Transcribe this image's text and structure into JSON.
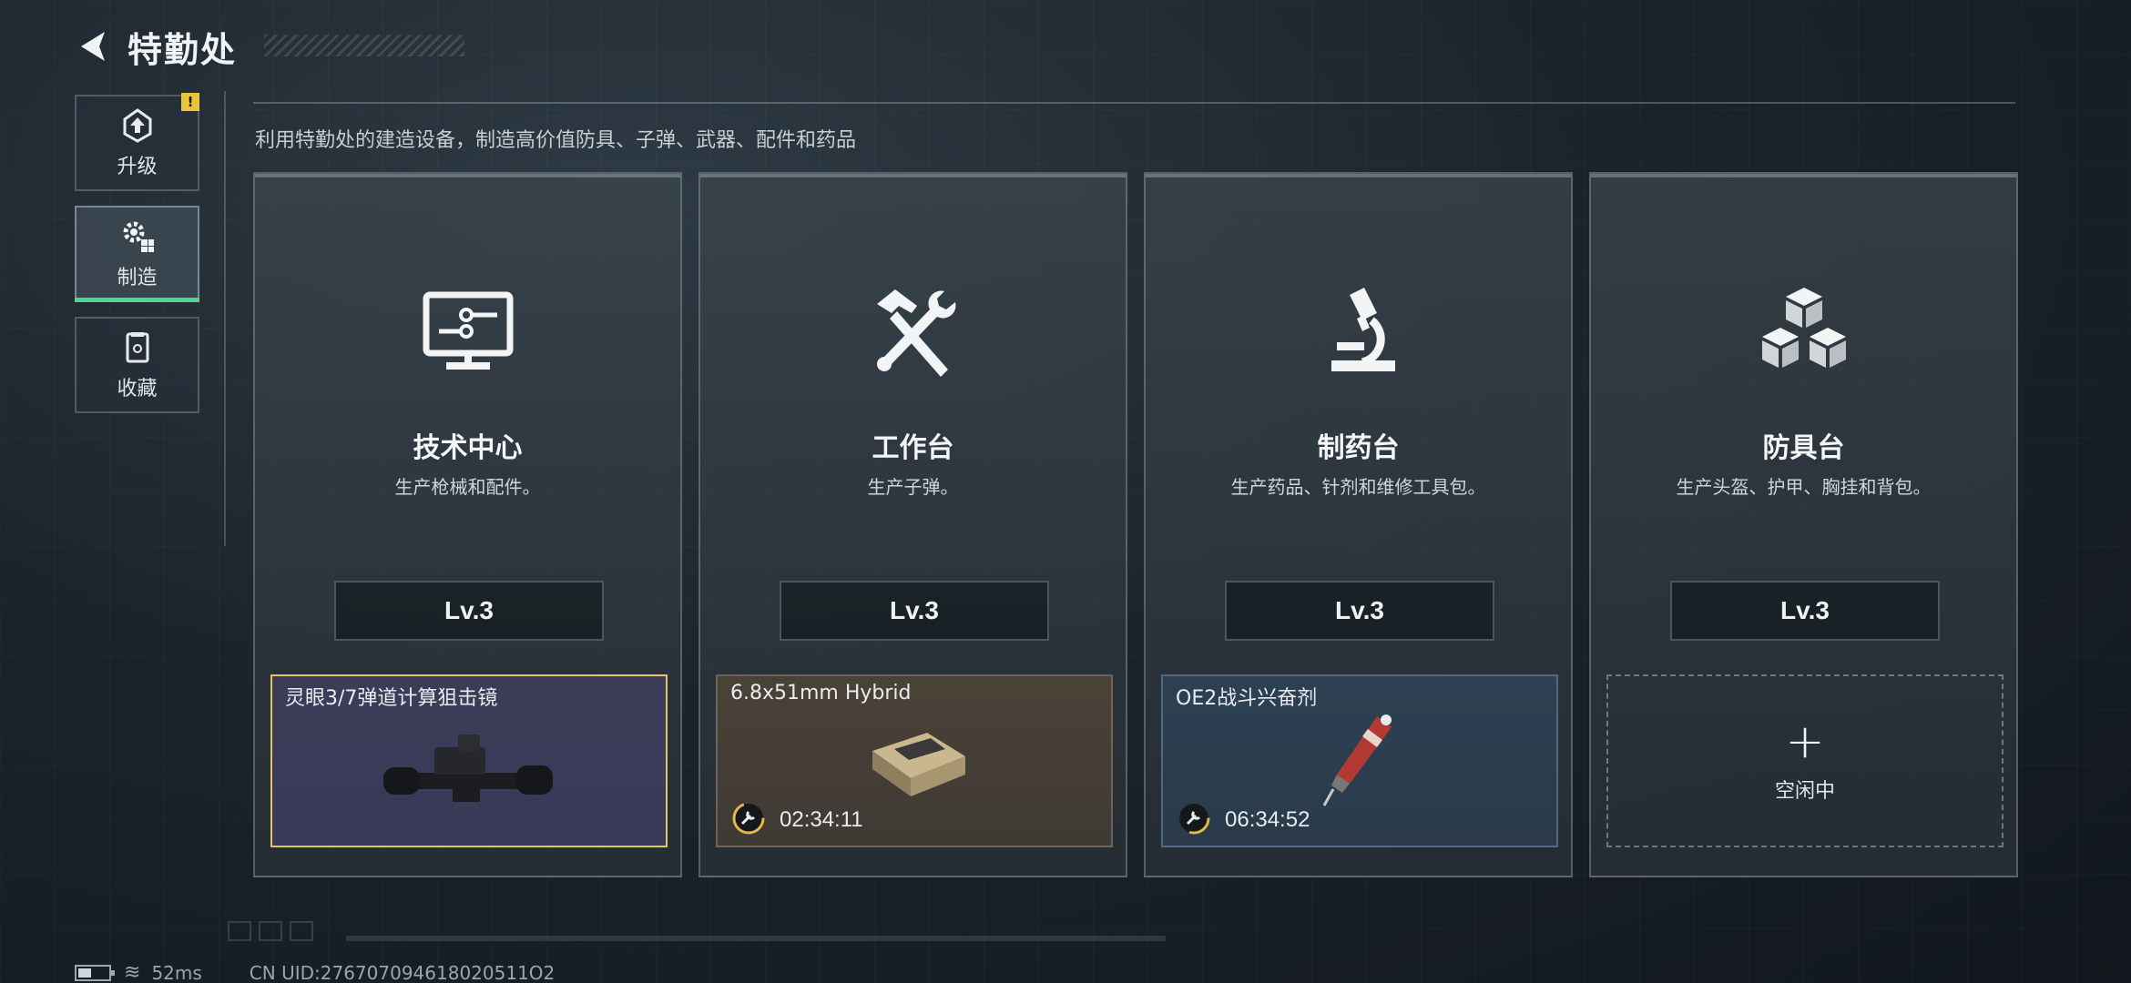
{
  "header": {
    "title": "特勤处"
  },
  "sidebar": {
    "items": [
      {
        "label": "升级",
        "icon": "upgrade-icon",
        "alert": "!"
      },
      {
        "label": "制造",
        "icon": "gears-icon",
        "active": true
      },
      {
        "label": "收藏",
        "icon": "collection-icon"
      }
    ]
  },
  "description": "利用特勤处的建造设备，制造高价值防具、子弹、武器、配件和药品",
  "cards": [
    {
      "title": "技术中心",
      "subtitle": "生产枪械和配件。",
      "level": "Lv.3",
      "icon": "monitor-circuit-icon",
      "slot": {
        "item": "灵眼3/7弹道计算狙击镜",
        "time": "",
        "state": "producing",
        "item_icon": "scope-icon"
      }
    },
    {
      "title": "工作台",
      "subtitle": "生产子弹。",
      "level": "Lv.3",
      "icon": "hammer-wrench-icon",
      "slot": {
        "item": "6.8x51mm Hybrid",
        "time": "02:34:11",
        "state": "producing",
        "item_icon": "ammo-box-icon"
      }
    },
    {
      "title": "制药台",
      "subtitle": "生产药品、针剂和维修工具包。",
      "level": "Lv.3",
      "icon": "microscope-icon",
      "slot": {
        "item": "OE2战斗兴奋剂",
        "time": "06:34:52",
        "state": "producing",
        "item_icon": "syringe-icon"
      }
    },
    {
      "title": "防具台",
      "subtitle": "生产头盔、护甲、胸挂和背包。",
      "level": "Lv.3",
      "icon": "cubes-icon",
      "slot": {
        "item": "",
        "time": "",
        "state": "idle",
        "idle_label": "空闲中",
        "item_icon": "plus-icon"
      }
    }
  ],
  "footer": {
    "ping": "52ms",
    "uid": "CN UID:276707094618020511O2"
  },
  "colors": {
    "accent": "#4fd49a",
    "alert": "#e8c53a",
    "gold_border": "#e3c765"
  }
}
